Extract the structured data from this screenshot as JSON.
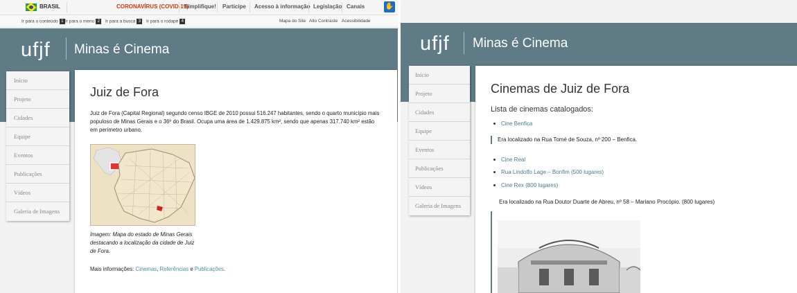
{
  "gov_bar": {
    "brasil": "BRASIL",
    "links": [
      "CORONAVÍRUS (COVID-19)",
      "Simplifique!",
      "Participe",
      "Acesso à informação",
      "Legislação",
      "Canais"
    ]
  },
  "access_bar": {
    "left": [
      {
        "label": "Ir para o conteúdo",
        "key": "1"
      },
      {
        "label": "Ir para o menu",
        "key": "2"
      },
      {
        "label": "Ir para a busca",
        "key": "3"
      },
      {
        "label": "Ir para o rodapé",
        "key": "4"
      }
    ],
    "right": [
      "Mapa do Site",
      "Alto Contraste",
      "Acessibilidade"
    ]
  },
  "site": {
    "logo": "ufjf",
    "title": "Minas é Cinema"
  },
  "nav": [
    "Início",
    "Projeto",
    "Cidades",
    "Equipe",
    "Eventos",
    "Publicações",
    "Vídeos",
    "Galeria de Imagens"
  ],
  "left_page": {
    "title": "Juiz de Fora",
    "paragraph": "Juiz de Fora (Capital Regional) segundo censo IBGE de 2010 possui  516.247 habitantes, sendo o quarto município mais populoso de Minas Gerais e o 36º do Brasil. Ocupa uma área de  1.429.875 km², sendo que apenas 317.740 km² estão em perímetro urbano.",
    "caption": "Imagem: Mapa do estado de Minas Gerais destacando a localização da cidade de Juiz de Fora.",
    "more_prefix": "Mais informações: ",
    "more_links": [
      "Cinemas",
      "Referências",
      "Publicações"
    ],
    "more_sep1": ", ",
    "more_sep2": " e ",
    "more_suffix": "."
  },
  "right_page": {
    "title": "Cinemas de Juiz de Fora",
    "subtitle": "Lista de cinemas catalogados:",
    "item1": "Cine Benfica",
    "quote1": "Era localizado na Rua Tomé de Souza, nº 200 – Benfica.",
    "item2": "Cine Real",
    "item3": "Rua Lindolfo Lage – Bonfim (500 lugares)",
    "item4": "Cine Rex (800 lugares)",
    "quote2": "Era localizado na Rua Doutor Duarte de Abreu, nº 58 – Mariano Procópio. (800 lugares)"
  },
  "colors": {
    "header": "#5e7b86",
    "link": "#4a8bb3",
    "covid": "#d4380d"
  }
}
